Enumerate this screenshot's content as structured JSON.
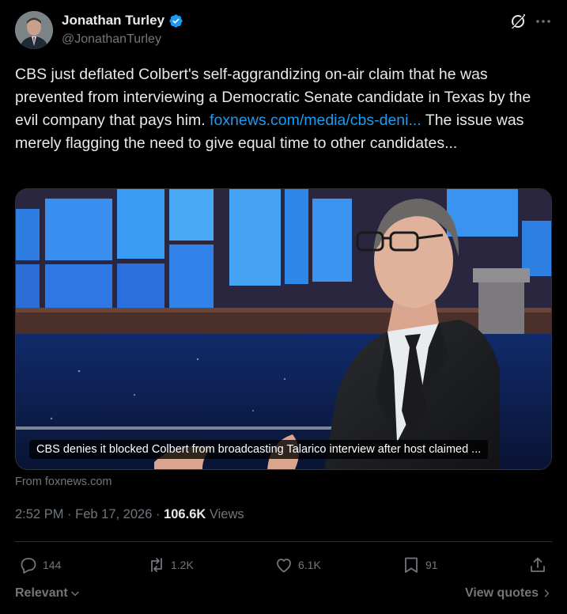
{
  "author": {
    "display_name": "Jonathan Turley",
    "handle": "@JonathanTurley",
    "verified_icon": "verified-badge-icon",
    "badge_color": "#1d9bf0"
  },
  "header_icons": [
    "grok-icon",
    "more-icon"
  ],
  "tweet": {
    "text_before_link": "CBS just deflated Colbert's self-aggrandizing on-air claim that he was prevented from interviewing a Democratic Senate candidate in Texas by the evil company that pays him. ",
    "link_text": "foxnews.com/media/cbs-deni...",
    "text_after_link": " The issue was merely flagging the need to give equal time to other candidates..."
  },
  "card": {
    "caption": "CBS denies it blocked Colbert from broadcasting Talarico interview after host claimed ...",
    "source": "From foxnews.com"
  },
  "meta": {
    "time": "2:52 PM",
    "separator": "·",
    "date": "Feb 17, 2026",
    "views_count": "106.6K",
    "views_label": "Views"
  },
  "actions": {
    "replies": "144",
    "reposts": "1.2K",
    "likes": "6.1K",
    "bookmarks": "91"
  },
  "footer": {
    "sort_label": "Relevant",
    "view_quotes_label": "View quotes"
  },
  "colors": {
    "background": "#000000",
    "text": "#e7e9ea",
    "muted": "#71767b",
    "link": "#1d9bf0",
    "divider": "#2f3336"
  }
}
